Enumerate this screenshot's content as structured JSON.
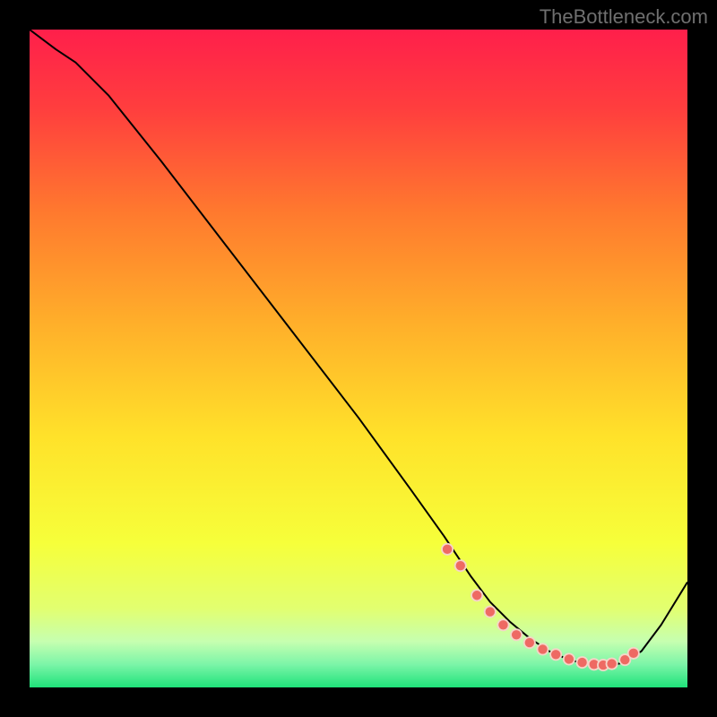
{
  "attribution": "TheBottleneck.com",
  "gradient": {
    "stops": [
      {
        "pos": 0,
        "color": "#ff1f4b"
      },
      {
        "pos": 0.12,
        "color": "#ff3e3e"
      },
      {
        "pos": 0.28,
        "color": "#ff7a2e"
      },
      {
        "pos": 0.45,
        "color": "#ffb02a"
      },
      {
        "pos": 0.62,
        "color": "#ffe22a"
      },
      {
        "pos": 0.78,
        "color": "#f6ff3a"
      },
      {
        "pos": 0.88,
        "color": "#e2ff70"
      },
      {
        "pos": 0.93,
        "color": "#c6ffb0"
      },
      {
        "pos": 0.965,
        "color": "#7cf5a8"
      },
      {
        "pos": 1.0,
        "color": "#1fe27a"
      }
    ]
  },
  "chart_data": {
    "type": "line",
    "title": "",
    "xlabel": "",
    "ylabel": "",
    "xlim": [
      0,
      100
    ],
    "ylim": [
      0,
      100
    ],
    "legend": false,
    "series": [
      {
        "name": "curve",
        "x": [
          0,
          4,
          7,
          12,
          20,
          30,
          40,
          50,
          58,
          63,
          67,
          70,
          73,
          76,
          79,
          82,
          85,
          88,
          90,
          93,
          96,
          100
        ],
        "y": [
          100,
          97,
          95,
          90,
          80,
          67,
          54,
          41,
          30,
          23,
          17,
          13,
          10,
          7.5,
          5.5,
          4.2,
          3.5,
          3.3,
          3.7,
          5.5,
          9.5,
          16
        ]
      }
    ],
    "markers": {
      "x": [
        63.5,
        65.5,
        68,
        70,
        72,
        74,
        76,
        78,
        80,
        82,
        84,
        85.8,
        87.2,
        88.5,
        90.5,
        91.8
      ],
      "y": [
        21,
        18.5,
        14,
        11.5,
        9.5,
        8,
        6.8,
        5.8,
        5,
        4.3,
        3.8,
        3.5,
        3.4,
        3.6,
        4.2,
        5.2
      ],
      "radius": 5.2,
      "outer_radius": 7.0,
      "fill": "#ee6a63",
      "ring": "#f5d5c8"
    },
    "line_color": "#000000",
    "line_width": 2
  }
}
